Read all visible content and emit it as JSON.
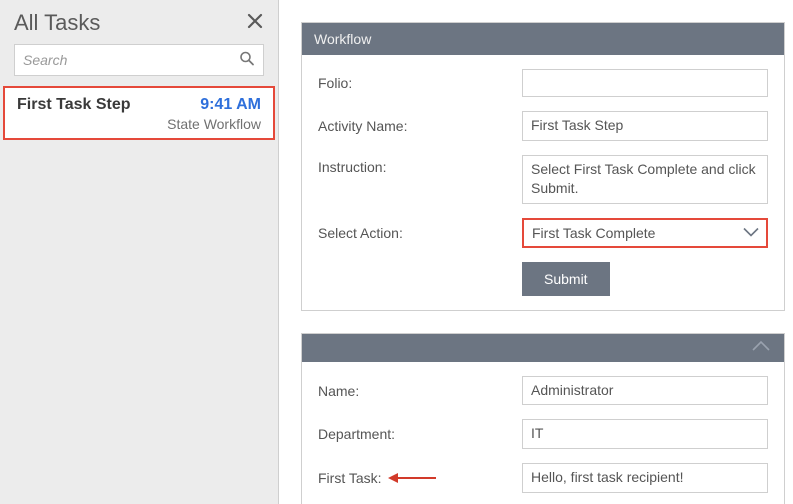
{
  "sidebar": {
    "title": "All Tasks",
    "searchPlaceholder": "Search",
    "task": {
      "name": "First Task Step",
      "time": "9:41 AM",
      "workflow": "State Workflow"
    }
  },
  "workflow": {
    "headerTitle": "Workflow",
    "fields": {
      "folioLabel": "Folio:",
      "folioValue": "",
      "activityLabel": "Activity Name:",
      "activityValue": "First Task Step",
      "instructionLabel": "Instruction:",
      "instructionValue": "Select First Task Complete and click Submit.",
      "selectActionLabel": "Select Action:",
      "selectActionValue": "First Task Complete",
      "submitLabel": "Submit"
    }
  },
  "details": {
    "nameLabel": "Name:",
    "nameValue": "Administrator",
    "departmentLabel": "Department:",
    "departmentValue": "IT",
    "firstTaskLabel": "First Task:",
    "firstTaskValue": "Hello, first task recipient!"
  }
}
